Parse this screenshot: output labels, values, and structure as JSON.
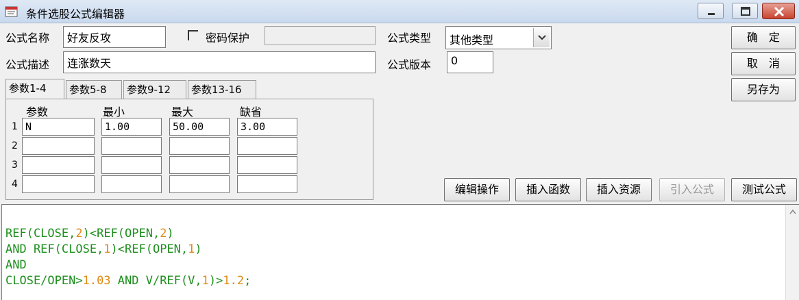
{
  "window": {
    "title": "条件选股公式编辑器",
    "controls": {
      "minimize_icon": "minimize-icon",
      "maximize_icon": "maximize-icon",
      "close_icon": "close-icon"
    }
  },
  "form": {
    "name_label": "公式名称",
    "name_value": "好友反攻",
    "password_label": "密码保护",
    "password_checked": false,
    "password_value": "",
    "desc_label": "公式描述",
    "desc_value": "连涨数天",
    "type_label": "公式类型",
    "type_value": "其他类型",
    "version_label": "公式版本",
    "version_value": "0"
  },
  "side_buttons": {
    "ok": "确　定",
    "cancel": "取　消",
    "save_as": "另存为"
  },
  "tabs": [
    "参数1-4",
    "参数5-8",
    "参数9-12",
    "参数13-16"
  ],
  "params": {
    "headers": [
      "参数",
      "最小",
      "最大",
      "缺省"
    ],
    "rows": [
      {
        "num": "1",
        "name": "N",
        "min": "1.00",
        "max": "50.00",
        "default": "3.00"
      },
      {
        "num": "2",
        "name": "",
        "min": "",
        "max": "",
        "default": ""
      },
      {
        "num": "3",
        "name": "",
        "min": "",
        "max": "",
        "default": ""
      },
      {
        "num": "4",
        "name": "",
        "min": "",
        "max": "",
        "default": ""
      }
    ]
  },
  "action_buttons": {
    "edit": "编辑操作",
    "insert_func": "插入函数",
    "insert_res": "插入资源",
    "import": "引入公式",
    "test": "测试公式"
  },
  "code": {
    "line1": [
      "REF(CLOSE,",
      "2",
      ")<REF(OPEN,",
      "2",
      ")"
    ],
    "line2": [
      "AND REF(CLOSE,",
      "1",
      ")<REF(OPEN,",
      "1",
      ")"
    ],
    "line3": [
      "AND"
    ],
    "line4": [
      "CLOSE/OPEN>",
      "1.03",
      " AND V/REF(V,",
      "1",
      ")>",
      "1.2",
      ";"
    ]
  },
  "colors": {
    "keyword": "#1d8f1d",
    "number": "#e08a14"
  }
}
